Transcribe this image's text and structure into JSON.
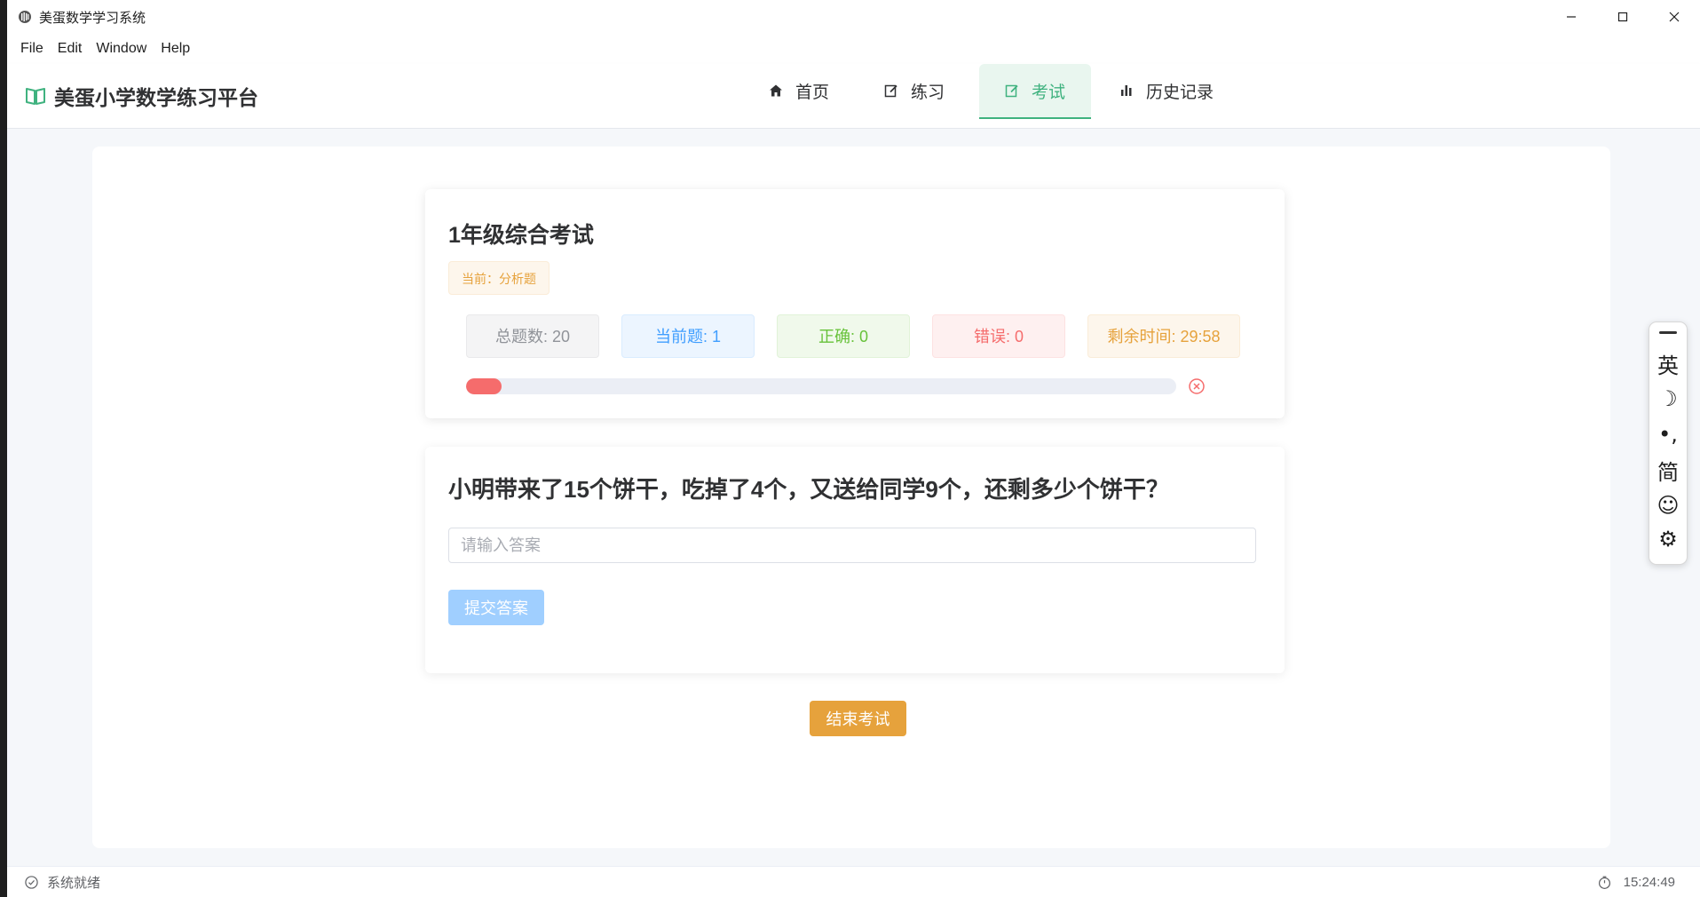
{
  "window": {
    "title": "美蛋数学学习系统"
  },
  "menu": [
    "File",
    "Edit",
    "Window",
    "Help"
  ],
  "header": {
    "brand": "美蛋小学数学练习平台",
    "nav": [
      {
        "label": "首页",
        "icon": "home-icon"
      },
      {
        "label": "练习",
        "icon": "edit-icon"
      },
      {
        "label": "考试",
        "icon": "edit-icon",
        "active": true
      },
      {
        "label": "历史记录",
        "icon": "bar-chart-icon"
      }
    ]
  },
  "exam": {
    "title": "1年级综合考试",
    "tag": "当前：分析题",
    "stats": {
      "total": "总题数: 20",
      "current": "当前题: 1",
      "correct": "正确: 0",
      "wrong": "错误: 0",
      "time": "剩余时间: 29:58"
    },
    "progress_percent": 5
  },
  "question": {
    "text": "小明带来了15个饼干，吃掉了4个，又送给同学9个，还剩多少个饼干？",
    "input_placeholder": "请输入答案",
    "input_value": "",
    "submit_label": "提交答案"
  },
  "end_button_label": "结束考试",
  "status": {
    "left": "系统就绪",
    "time": "15:24:49"
  },
  "ime": [
    "英",
    "☽",
    "•,",
    "简",
    "☺",
    "⚙"
  ],
  "colors": {
    "accent": "#3fb27f",
    "warning": "#e6a23c",
    "danger": "#f56c6c",
    "primary_light": "#a0cfff"
  }
}
